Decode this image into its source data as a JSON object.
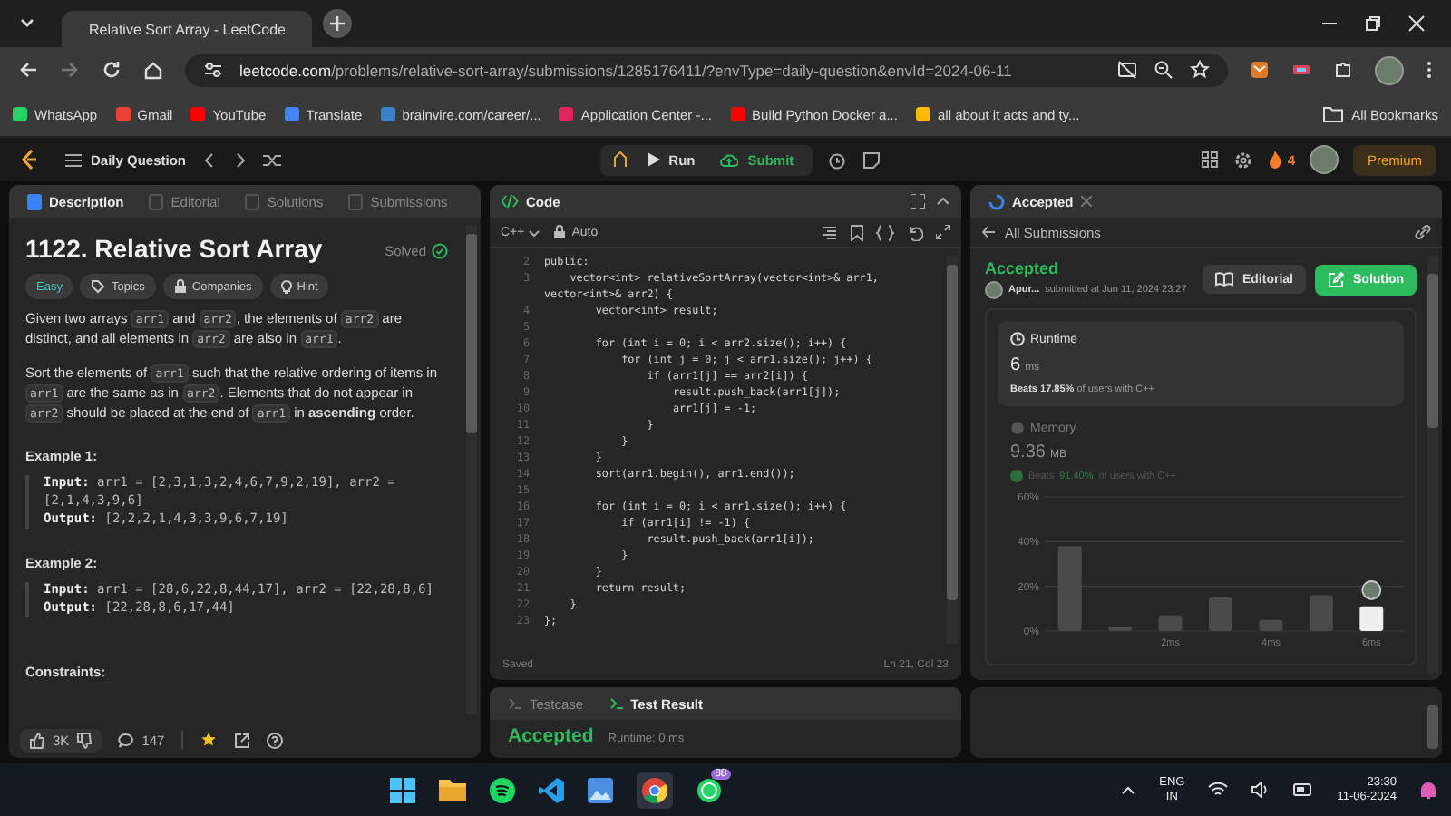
{
  "browser": {
    "tab_title": "Relative Sort Array - LeetCode",
    "url_host": "leetcode.com",
    "url_path": "/problems/relative-sort-array/submissions/1285176411/?envType=daily-question&envId=2024-06-11",
    "bookmarks": [
      {
        "label": "WhatsApp",
        "color": "#25d366"
      },
      {
        "label": "Gmail",
        "color": "#ea4335"
      },
      {
        "label": "YouTube",
        "color": "#ff0000"
      },
      {
        "label": "Translate",
        "color": "#4285f4"
      },
      {
        "label": "brainvire.com/career/...",
        "color": "#3b82c4"
      },
      {
        "label": "Application Center -...",
        "color": "#e0245e"
      },
      {
        "label": "Build Python Docker a...",
        "color": "#ff0000"
      },
      {
        "label": "all about it acts and ty...",
        "color": "#fbbc05"
      }
    ],
    "all_bookmarks": "All Bookmarks"
  },
  "topbar": {
    "title": "Daily Question",
    "run": "Run",
    "submit": "Submit",
    "streak": "4",
    "premium": "Premium"
  },
  "description": {
    "tabs": [
      {
        "label": "Description",
        "selected": true
      },
      {
        "label": "Editorial",
        "selected": false
      },
      {
        "label": "Solutions",
        "selected": false
      },
      {
        "label": "Submissions",
        "selected": false
      }
    ],
    "title": "1122. Relative Sort Array",
    "status": "Solved",
    "tags": [
      {
        "label": "Easy",
        "kind": "difficulty"
      },
      {
        "label": "Topics",
        "kind": "topics"
      },
      {
        "label": "Companies",
        "kind": "companies"
      },
      {
        "label": "Hint",
        "kind": "hint"
      }
    ],
    "paragraphs": [
      [
        {
          "kind": "text",
          "text": "Given two arrays "
        },
        {
          "kind": "code",
          "text": "arr1"
        },
        {
          "kind": "text",
          "text": " and "
        },
        {
          "kind": "code",
          "text": "arr2"
        },
        {
          "kind": "text",
          "text": ", the elements of "
        },
        {
          "kind": "code",
          "text": "arr2"
        },
        {
          "kind": "text",
          "text": " are distinct, and all elements in "
        },
        {
          "kind": "code",
          "text": "arr2"
        },
        {
          "kind": "text",
          "text": " are also in "
        },
        {
          "kind": "code",
          "text": "arr1"
        },
        {
          "kind": "text",
          "text": "."
        }
      ],
      [
        {
          "kind": "text",
          "text": "Sort the elements of "
        },
        {
          "kind": "code",
          "text": "arr1"
        },
        {
          "kind": "text",
          "text": " such that the relative ordering of items in "
        },
        {
          "kind": "code",
          "text": "arr1"
        },
        {
          "kind": "text",
          "text": " are the same as in "
        },
        {
          "kind": "code",
          "text": "arr2"
        },
        {
          "kind": "text",
          "text": ". Elements that do not appear in "
        },
        {
          "kind": "code",
          "text": "arr2"
        },
        {
          "kind": "text",
          "text": " should be placed at the end of "
        },
        {
          "kind": "code",
          "text": "arr1"
        },
        {
          "kind": "text",
          "text": " in "
        },
        {
          "kind": "bold",
          "text": "ascending"
        },
        {
          "kind": "text",
          "text": " order."
        }
      ]
    ],
    "examples": [
      {
        "heading": "Example 1:",
        "input": "**Input:** arr1 = [2,3,1,3,2,4,6,7,9,2,19], arr2 = [2,1,4,3,9,6]",
        "output": "**Output:** [2,2,2,1,4,3,3,9,6,7,19]"
      },
      {
        "heading": "Example 2:",
        "input": "**Input:** arr1 = [28,6,22,8,44,17], arr2 = [22,28,8,6]",
        "output": "**Output:** [22,28,8,6,17,44]"
      }
    ],
    "constraints_heading": "Constraints:",
    "likes": "3K",
    "comments": "147"
  },
  "editor": {
    "title": "Code",
    "language": "C++",
    "mode": "Auto",
    "lines": [
      {
        "n": "2",
        "text": "public:"
      },
      {
        "n": "3",
        "text": "    vector<int> relativeSortArray(vector<int>& arr1, vector<int>& arr2) {"
      },
      {
        "n": "4",
        "text": "        vector<int> result;"
      },
      {
        "n": "5"
      },
      {
        "n": "6",
        "text": "        for (int i = 0; i < arr2.size(); i++) {"
      },
      {
        "n": "7",
        "text": "            for (int j = 0; j < arr1.size(); j++) {"
      },
      {
        "n": "8",
        "text": "                if (arr1[j] == arr2[i]) {"
      },
      {
        "n": "9",
        "text": "                    result.push_back(arr1[j]);"
      },
      {
        "n": "10",
        "text": "                    arr1[j] = -1;"
      },
      {
        "n": "11",
        "text": "                }"
      },
      {
        "n": "12",
        "text": "            }"
      },
      {
        "n": "13",
        "text": "        }"
      },
      {
        "n": "14",
        "text": "        sort(arr1.begin(), arr1.end());"
      },
      {
        "n": "15"
      },
      {
        "n": "16",
        "text": "        for (int i = 0; i < arr1.size(); i++) {"
      },
      {
        "n": "17",
        "text": "            if (arr1[i] != -1) {"
      },
      {
        "n": "18",
        "text": "                result.push_back(arr1[i]);"
      },
      {
        "n": "19",
        "text": "            }"
      },
      {
        "n": "20",
        "text": "        }"
      },
      {
        "n": "21",
        "text": "        return result;"
      },
      {
        "n": "22",
        "text": "    }"
      },
      {
        "n": "23",
        "text": "};"
      }
    ],
    "status": "Saved",
    "cursor": "Ln 21, Col 23"
  },
  "test_panel": {
    "tabs": [
      {
        "label": "Testcase",
        "selected": false
      },
      {
        "label": "Test Result",
        "selected": true
      }
    ],
    "verdict": "Accepted",
    "runtime": "Runtime: 0 ms"
  },
  "submission": {
    "tab": "Accepted",
    "back": "All Submissions",
    "verdict": "Accepted",
    "user": "Apur...",
    "submitted": "submitted at Jun 11, 2024 23:27",
    "editorial": "Editorial",
    "solution": "Solution",
    "runtime": {
      "label": "Runtime",
      "value": "6",
      "unit": "ms",
      "beats": "Beats",
      "percent": "17.85%",
      "suffix": "of users with C++"
    },
    "memory": {
      "label": "Memory",
      "value": "9.36",
      "unit": "MB",
      "beats": "Beats",
      "percent": "91.40%",
      "suffix": "of users with C++"
    },
    "chart_data": {
      "type": "bar",
      "x": [
        0,
        1,
        2,
        3,
        4,
        5,
        6
      ],
      "xlim": [
        -0.5,
        6.5
      ],
      "series": [
        {
          "color": "#4a4a4a",
          "values": [
            38,
            2,
            7,
            15,
            5,
            16,
            null
          ]
        },
        {
          "color": "#f0f0f0",
          "values": [
            null,
            null,
            null,
            null,
            null,
            null,
            11
          ]
        }
      ],
      "ylim": [
        0,
        60
      ],
      "yticks": [
        {
          "value": 0,
          "label": "0%"
        },
        {
          "value": 20,
          "label": "20%"
        },
        {
          "value": 40,
          "label": "40%"
        },
        {
          "value": 60,
          "label": "60%"
        }
      ],
      "xticks": [
        {
          "value": 2,
          "label": "2ms"
        },
        {
          "value": 4,
          "label": "4ms"
        },
        {
          "value": 6,
          "label": "6ms"
        }
      ],
      "stacked": true
    }
  },
  "taskbar": {
    "whatsapp_badge": "88",
    "lang": "ENG",
    "region": "IN",
    "time": "23:30",
    "date": "11-06-2024"
  }
}
